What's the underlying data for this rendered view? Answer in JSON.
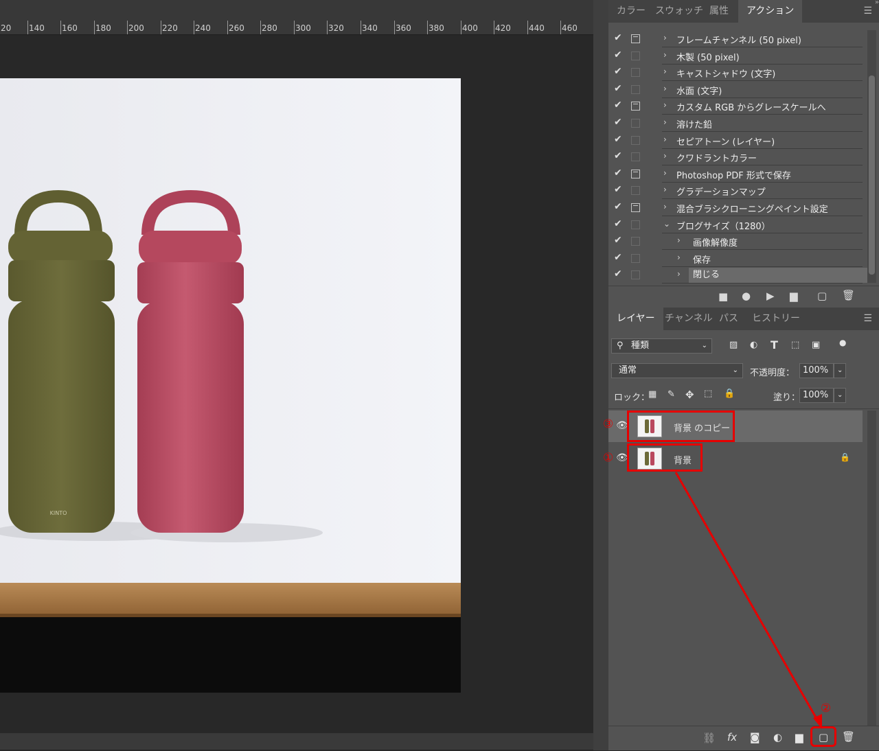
{
  "ruler": {
    "ticks": [
      "20",
      "140",
      "160",
      "180",
      "200",
      "220",
      "240",
      "260",
      "280",
      "300",
      "320",
      "340",
      "360",
      "380",
      "400",
      "420",
      "440",
      "460"
    ]
  },
  "canvas": {
    "brand_text": "KINTO",
    "colors": {
      "olive": "#6b6a3a",
      "rose": "#b84a60",
      "wood": "#a47a4a"
    }
  },
  "actions_panel": {
    "tabs": [
      "カラー",
      "スウォッチ",
      "属性",
      "アクション"
    ],
    "active_tab": "アクション",
    "menu_icon": "hamburger-menu-icon",
    "rows": [
      {
        "label": "フレームチャンネル (50 pixel)",
        "dialog": true,
        "chevron": "›"
      },
      {
        "label": "木製 (50 pixel)",
        "dialog": false,
        "chevron": "›"
      },
      {
        "label": "キャストシャドウ (文字)",
        "dialog": false,
        "chevron": "›"
      },
      {
        "label": "水面 (文字)",
        "dialog": false,
        "chevron": "›"
      },
      {
        "label": "カスタム RGB からグレースケールへ",
        "dialog": true,
        "chevron": "›"
      },
      {
        "label": "溶けた鉛",
        "dialog": false,
        "chevron": "›"
      },
      {
        "label": "セピアトーン (レイヤー)",
        "dialog": false,
        "chevron": "›"
      },
      {
        "label": "クワドラントカラー",
        "dialog": false,
        "chevron": "›"
      },
      {
        "label": "Photoshop PDF 形式で保存",
        "dialog": true,
        "chevron": "›"
      },
      {
        "label": "グラデーションマップ",
        "dialog": false,
        "chevron": "›"
      },
      {
        "label": "混合ブラシクローニングペイント設定",
        "dialog": true,
        "chevron": "›"
      },
      {
        "label": "ブログサイズ（1280）",
        "dialog": false,
        "chevron": "⌄"
      },
      {
        "label": "画像解像度",
        "dialog": false,
        "chevron": "›",
        "indent": true
      },
      {
        "label": "保存",
        "dialog": false,
        "chevron": "›",
        "indent": true
      },
      {
        "label": "閉じる",
        "dialog": false,
        "chevron": "›",
        "indent": true,
        "selected": true
      }
    ],
    "check": "✔",
    "buttons": [
      "stop-icon",
      "record-icon",
      "play-icon",
      "folder-icon",
      "new-action-icon",
      "trash-icon"
    ]
  },
  "layers_panel": {
    "tabs": [
      "レイヤー",
      "チャンネル",
      "パス",
      "ヒストリー"
    ],
    "active_tab": "レイヤー",
    "filter_label": "種類",
    "blend_mode": "通常",
    "opacity_label": "不透明度：",
    "opacity_value": "100%",
    "lock_label": "ロック：",
    "fill_label": "塗り：",
    "fill_value": "100%",
    "layers": [
      {
        "name": "背景 のコピー",
        "marker": "③",
        "selected": true
      },
      {
        "name": "背景",
        "marker": "①",
        "locked": true
      }
    ],
    "bottom_marker": "②",
    "bottom_buttons": [
      "link-icon",
      "fx-icon",
      "mask-icon",
      "adjustment-icon",
      "group-folder-icon",
      "new-layer-icon",
      "delete-icon"
    ]
  }
}
